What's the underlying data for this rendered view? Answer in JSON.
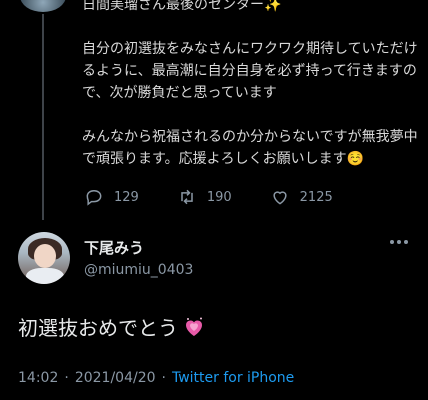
{
  "parent_tweet": {
    "line1": "日間美瑠さん最後のセンター✨",
    "para2": "自分の初選抜をみなさんにワクワク期待していただけるように、最高潮に自分自身を必ず持って行きますので、次が勝負だと思っています",
    "para3": "みんなから祝福されるのか分からないですが無我夢中で頑張ります。応援よろしくお願いします☺️",
    "replies": "129",
    "retweets": "190",
    "likes": "2125"
  },
  "reply_tweet": {
    "display_name": "下尾みう",
    "handle": "@miumiu_0403",
    "text": "初選抜おめでとう",
    "time": "14:02",
    "date": "2021/04/20",
    "separator": "·",
    "source": "Twitter for iPhone"
  },
  "colors": {
    "background": "#000000",
    "secondary_text": "#8b98a5",
    "link": "#1d9bf0"
  }
}
